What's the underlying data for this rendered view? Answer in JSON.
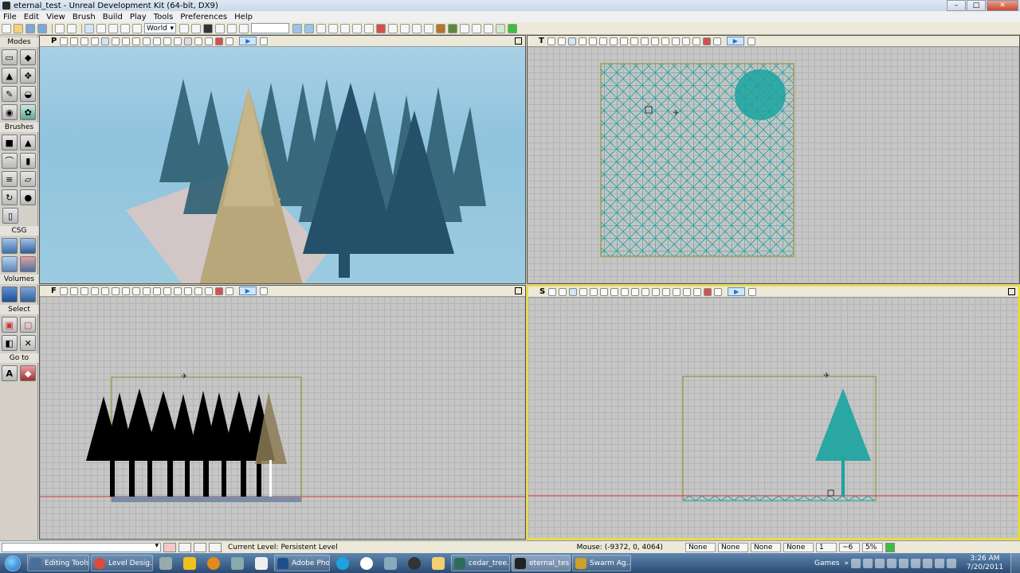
{
  "window": {
    "title": "eternal_test - Unreal Development Kit (64-bit, DX9)",
    "minimize": "–",
    "maximize": "□",
    "close": "✕"
  },
  "menu": [
    "File",
    "Edit",
    "View",
    "Brush",
    "Build",
    "Play",
    "Tools",
    "Preferences",
    "Help"
  ],
  "toolbar": {
    "coord_system": "World"
  },
  "modes": {
    "title": "Modes",
    "brushes": "Brushes",
    "csg": "CSG",
    "volumes": "Volumes",
    "select": "Select",
    "goto": "Go to"
  },
  "viewports": {
    "perspective": {
      "letter": "P"
    },
    "top": {
      "letter": "T"
    },
    "front": {
      "letter": "F"
    },
    "side": {
      "letter": "S"
    }
  },
  "statusbar": {
    "current_level_label": "Current Level:",
    "current_level_value": "Persistent Level",
    "mouse": "Mouse: (-9372, 0, 4064)",
    "fields": [
      "None",
      "None",
      "None",
      "None"
    ],
    "grid": "1",
    "rotation": "~6",
    "scale": "5%"
  },
  "taskbar": {
    "items": [
      {
        "label": "Editing Tools",
        "color": "#4a6f96"
      },
      {
        "label": "Level Desig...",
        "color": "#e04a3c"
      },
      {
        "label": "Adobe Pho...",
        "color": "#1d4f8c"
      },
      {
        "label": "cedar_tree...",
        "color": "#2c6d5a"
      },
      {
        "label": "eternal_tes...",
        "color": "#222222"
      },
      {
        "label": "Swarm Ag...",
        "color": "#c9a227"
      }
    ],
    "tray_label": "Games",
    "time": "3:26 AM",
    "date": "7/20/2011"
  }
}
